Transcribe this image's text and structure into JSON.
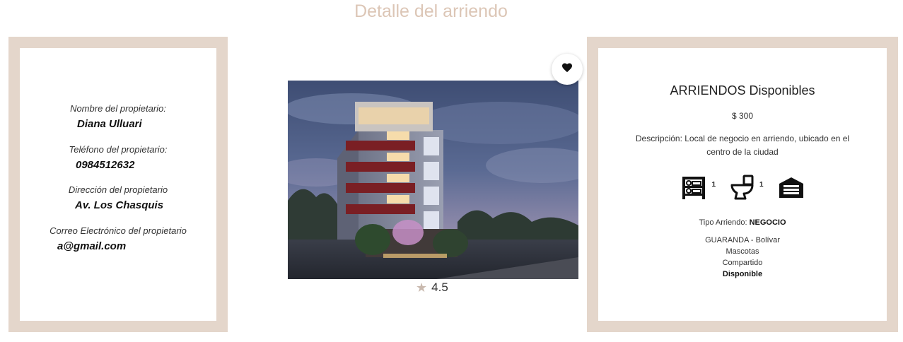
{
  "page": {
    "title": "Detalle del arriendo"
  },
  "owner": {
    "name_label": "Nombre del propietario:",
    "name": "Diana Ulluari",
    "phone_label": "Teléfono del propietario:",
    "phone": "0984512632",
    "address_label": "Dirección del propietario",
    "address": "Av. Los Chasquis",
    "email_label": "Correo Electrónico del propietario",
    "email": "a@gmail.com"
  },
  "listing": {
    "rating": "4.5",
    "favorite_icon": "heart-icon"
  },
  "details": {
    "title": "ARRIENDOS Disponibles",
    "price": "$ 300",
    "description": "Descripción: Local de negocio en arriendo, ubicado en el centro de la ciudad",
    "bedrooms": "1",
    "bathrooms": "1",
    "type_label": "Tipo Arriendo:",
    "type_value": "NEGOCIO",
    "location": "GUARANDA - Bolívar",
    "pets": "Mascotas",
    "shared": "Compartido",
    "status": "Disponible"
  },
  "colors": {
    "accent": "#e4d6cb",
    "title": "#dcc6b6"
  }
}
